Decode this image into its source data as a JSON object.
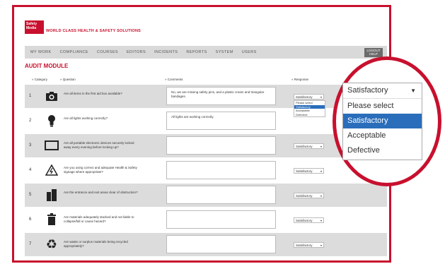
{
  "brand": {
    "logo_text": "Safety Media",
    "tagline": "WORLD CLASS HEALTH & SAFETY SOLUTIONS"
  },
  "nav": {
    "items": [
      "MY WORK",
      "COMPLIANCE",
      "COURSES",
      "EDITORS",
      "INCIDENTS",
      "REPORTS",
      "SYSTEM",
      "USERS"
    ],
    "logout_label": "LOGOUT",
    "help_label": "HELP"
  },
  "module_title": "AUDIT MODULE",
  "columns": {
    "category": "» Category",
    "question": "» Question",
    "comments": "» Comments",
    "response": "» Response"
  },
  "rows": [
    {
      "num": "1",
      "icon": "camera-icon",
      "question": "Are all items in the first aid box available?",
      "comment": "No, we are missing safety pins, and a plastic cream and triangular bandages.",
      "response": "Satisfactory"
    },
    {
      "num": "2",
      "icon": "lightbulb-icon",
      "question": "Are all lights working correctly?",
      "comment": "All lights are working correctly.",
      "response": ""
    },
    {
      "num": "3",
      "icon": "monitor-icon",
      "question": "Are all portable electronic devices securely locked away every evening before locking up?",
      "comment": "",
      "response": "Satisfactory"
    },
    {
      "num": "4",
      "icon": "electric-hazard-icon",
      "question": "Are you using correct and adequate Health & Safety signage where appropriate?",
      "comment": "",
      "response": "Satisfactory"
    },
    {
      "num": "5",
      "icon": "building-icon",
      "question": "Are the entrance and exit areas clear of obstruction?",
      "comment": "",
      "response": "Satisfactory"
    },
    {
      "num": "6",
      "icon": "trash-bin-icon",
      "question": "Are materials adequately stacked and not liable to collapse/fall or cause hazard?",
      "comment": "",
      "response": "Satisfactory"
    },
    {
      "num": "7",
      "icon": "recycle-icon",
      "question": "Are waste or surplus materials being recycled appropriately?",
      "comment": "",
      "response": "Satisfactory"
    }
  ],
  "mini_dropdown": {
    "options": [
      "Please select",
      "Satisfactory",
      "Acceptable",
      "Defective"
    ],
    "selected": "Satisfactory"
  },
  "zoom_dropdown": {
    "value": "Satisfactory",
    "options": [
      "Please select",
      "Satisfactory",
      "Acceptable",
      "Defective"
    ],
    "selected": "Satisfactory"
  },
  "colors": {
    "brand_red": "#c8102e",
    "highlight_blue": "#2a6ebb"
  }
}
